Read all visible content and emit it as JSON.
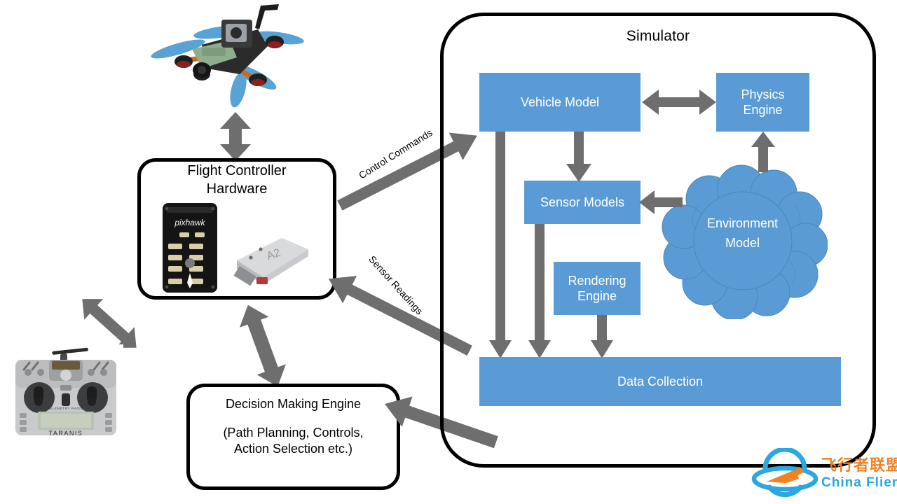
{
  "diagram": {
    "title": "Simulator",
    "simulator": {
      "label": "Simulator",
      "blocks": [
        {
          "id": "vehicle-model",
          "label": "Vehicle Model"
        },
        {
          "id": "physics-engine",
          "label": "Physics\nEngine",
          "line1": "Physics",
          "line2": "Engine"
        },
        {
          "id": "sensor-models",
          "label": "Sensor Models"
        },
        {
          "id": "rendering-engine",
          "label": "Rendering\nEngine",
          "line1": "Rendering",
          "line2": "Engine"
        },
        {
          "id": "data-collection",
          "label": "Data Collection"
        }
      ],
      "cloud": {
        "id": "environment-model",
        "line1": "Environment",
        "line2": "Model"
      }
    },
    "hardware": {
      "title_line1": "Flight Controller",
      "title_line2": "Hardware",
      "photo_labels": [
        "pixhawk",
        "A2"
      ]
    },
    "decision_engine": {
      "line1": "Decision Making Engine",
      "line2": "(Path Planning, Controls,",
      "line3": "Action Selection etc.)"
    },
    "connector_labels": {
      "control_commands": "Control Commands",
      "sensor_readings": "Sensor Readings"
    },
    "photos": {
      "drone": "quadcopter-photo",
      "transmitter": "rc-transmitter-photo",
      "transmitter_brand": "TARANIS",
      "flight_controllers": "pixhawk-and-a2-photo"
    },
    "watermark": {
      "cn_text": "飞行者联盟",
      "en_text": "China Flier"
    },
    "colors": {
      "block_blue": "#5B9BD5",
      "arrow_gray": "#6E6E6E",
      "outline_black": "#000000",
      "logo_blue": "#29A9E0",
      "logo_orange": "#F08221",
      "text_white": "#FFFFFF"
    }
  }
}
